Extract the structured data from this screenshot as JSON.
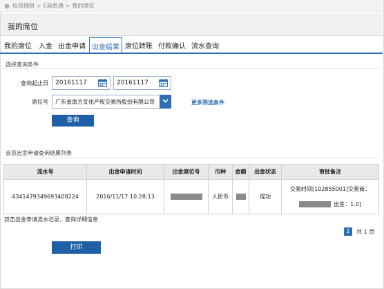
{
  "breadcrumb": [
    "投资理财",
    "E商贸通",
    "我的席位"
  ],
  "page_title": "我的席位",
  "tabs": [
    {
      "label": "我的席位",
      "active": false
    },
    {
      "label": "入金",
      "active": false
    },
    {
      "label": "出金申请",
      "active": false
    },
    {
      "label": "出金结果",
      "active": true
    },
    {
      "label": "席位转账",
      "active": false
    },
    {
      "label": "付款确认",
      "active": false
    },
    {
      "label": "流水查询",
      "active": false
    }
  ],
  "query": {
    "section_title": "选择查询条件",
    "date_label": "查询起止日",
    "start_date": "20161117",
    "end_date": "20161117",
    "seat_label": "席位号",
    "seat_value": "广东省南方文化产权交易所股份有限公司",
    "more_filters": "更多筛选条件",
    "search_button": "查询"
  },
  "results": {
    "section_title": "会员出金申请查询结果列表",
    "columns": [
      "流水号",
      "出金申请时间",
      "出金席位号",
      "币种",
      "金额",
      "出金状态",
      "审批备注"
    ],
    "rows": [
      {
        "serial": "4341479349693408224",
        "time": "2016/11/17 10:28:13",
        "seat": "",
        "currency": "人民币",
        "amount": "",
        "status": "成功",
        "memo_line1": "交易时间[102855001]交易商：",
        "memo_line2": "出金：1.0]"
      }
    ],
    "hint": "双击出金申请流水记录，查询详细信息"
  },
  "pagination": {
    "current": "1",
    "total": "共 1 页"
  },
  "print_button": "打印",
  "colors": {
    "accent": "#2d6db4",
    "button": "#1f5fa6",
    "header_bg": "#e9e9e9",
    "mask": "#8a8a8a"
  }
}
